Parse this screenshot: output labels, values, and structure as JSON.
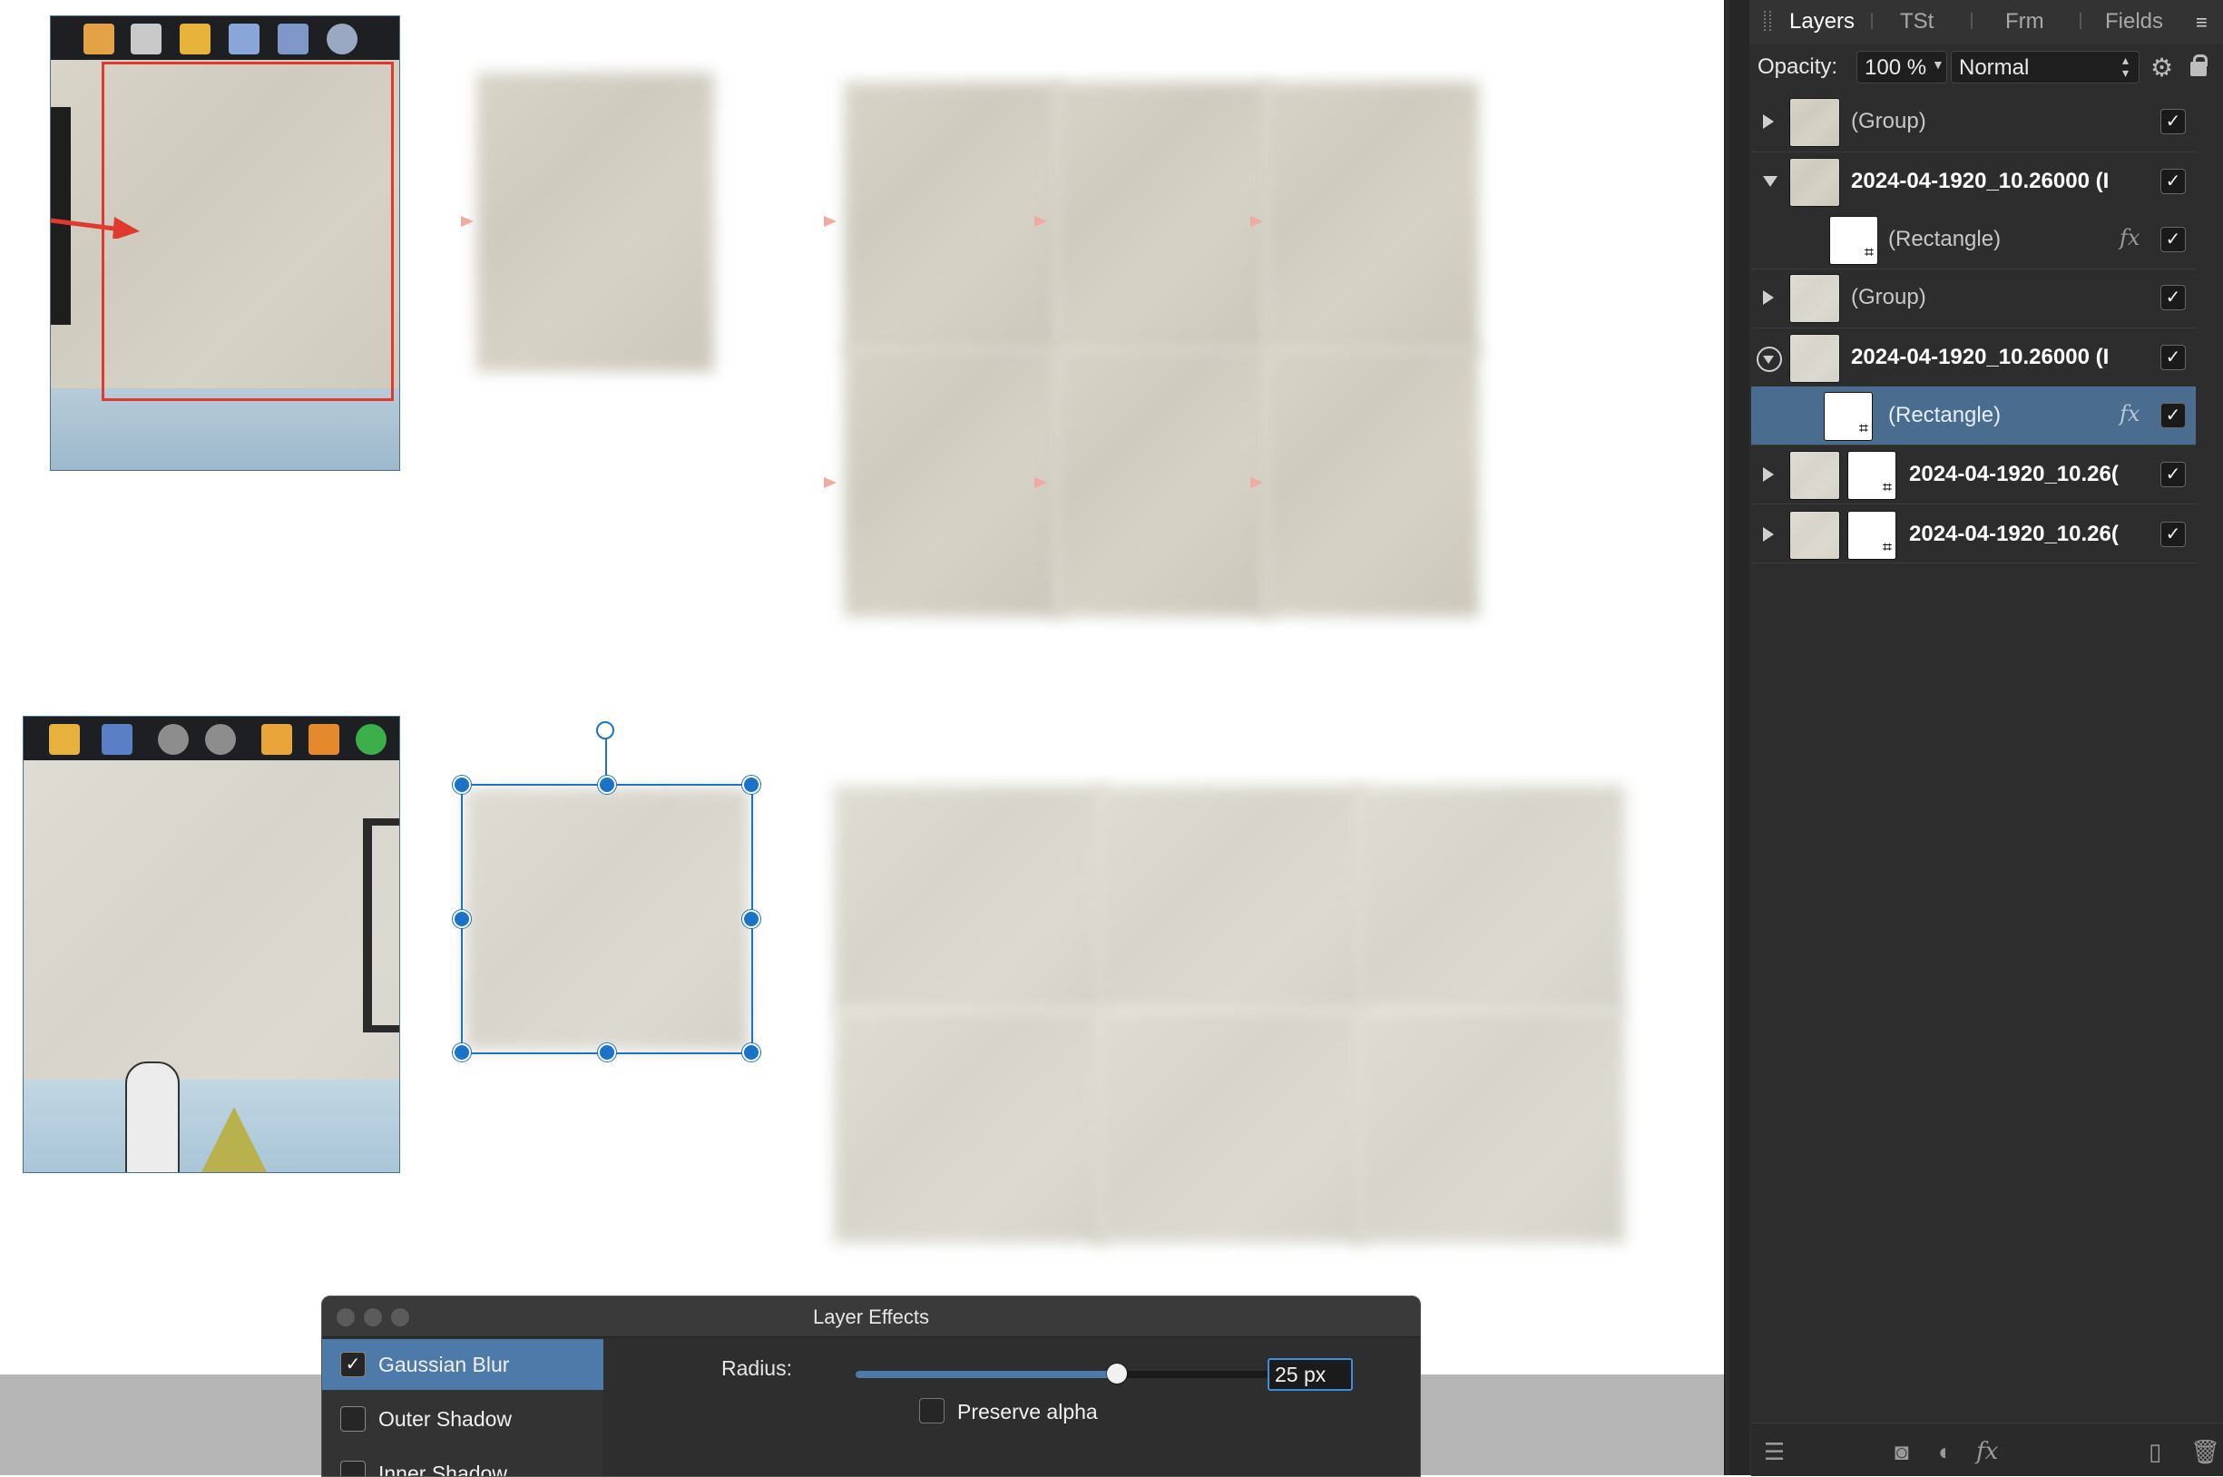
{
  "layers_panel": {
    "tabs": [
      {
        "label": "Layers",
        "active": true
      },
      {
        "label": "TSt",
        "active": false
      },
      {
        "label": "Frm",
        "active": false
      },
      {
        "label": "Fields",
        "active": false
      }
    ],
    "opacity_label": "Opacity:",
    "opacity_value": "100 %",
    "blend_mode": "Normal",
    "layers": [
      {
        "name": "(Group)",
        "bold": false,
        "checked": true
      },
      {
        "name": "2024-04-1920_10.26000 (I",
        "bold": true,
        "checked": true
      },
      {
        "name": "(Rectangle)",
        "bold": false,
        "checked": true,
        "fx": "fx"
      },
      {
        "name": "(Group)",
        "bold": false,
        "checked": true
      },
      {
        "name": "2024-04-1920_10.26000 (I",
        "bold": true,
        "checked": true
      },
      {
        "name": "(Rectangle)",
        "bold": false,
        "checked": true,
        "fx": "fx",
        "selected": true
      },
      {
        "name": "2024-04-1920_10.26(",
        "bold": true,
        "checked": true
      },
      {
        "name": "2024-04-1920_10.26(",
        "bold": true,
        "checked": true
      }
    ]
  },
  "dialog": {
    "title": "Layer Effects",
    "effects": [
      {
        "label": "Gaussian Blur",
        "checked": true,
        "active": true
      },
      {
        "label": "Outer Shadow",
        "checked": false,
        "active": false
      },
      {
        "label": "Inner Shadow",
        "checked": false,
        "active": false
      }
    ],
    "radius_label": "Radius:",
    "radius_value": "25 px",
    "radius_level": 0.6,
    "preserve_alpha_label": "Preserve alpha",
    "preserve_alpha_checked": false
  },
  "colors": {
    "accent": "#1a73c9",
    "panel_bg": "#2d2d2d",
    "selected_row": "#4a6d8f",
    "effect_active": "#4d7aa8",
    "guide_red": "#e03a2e"
  }
}
